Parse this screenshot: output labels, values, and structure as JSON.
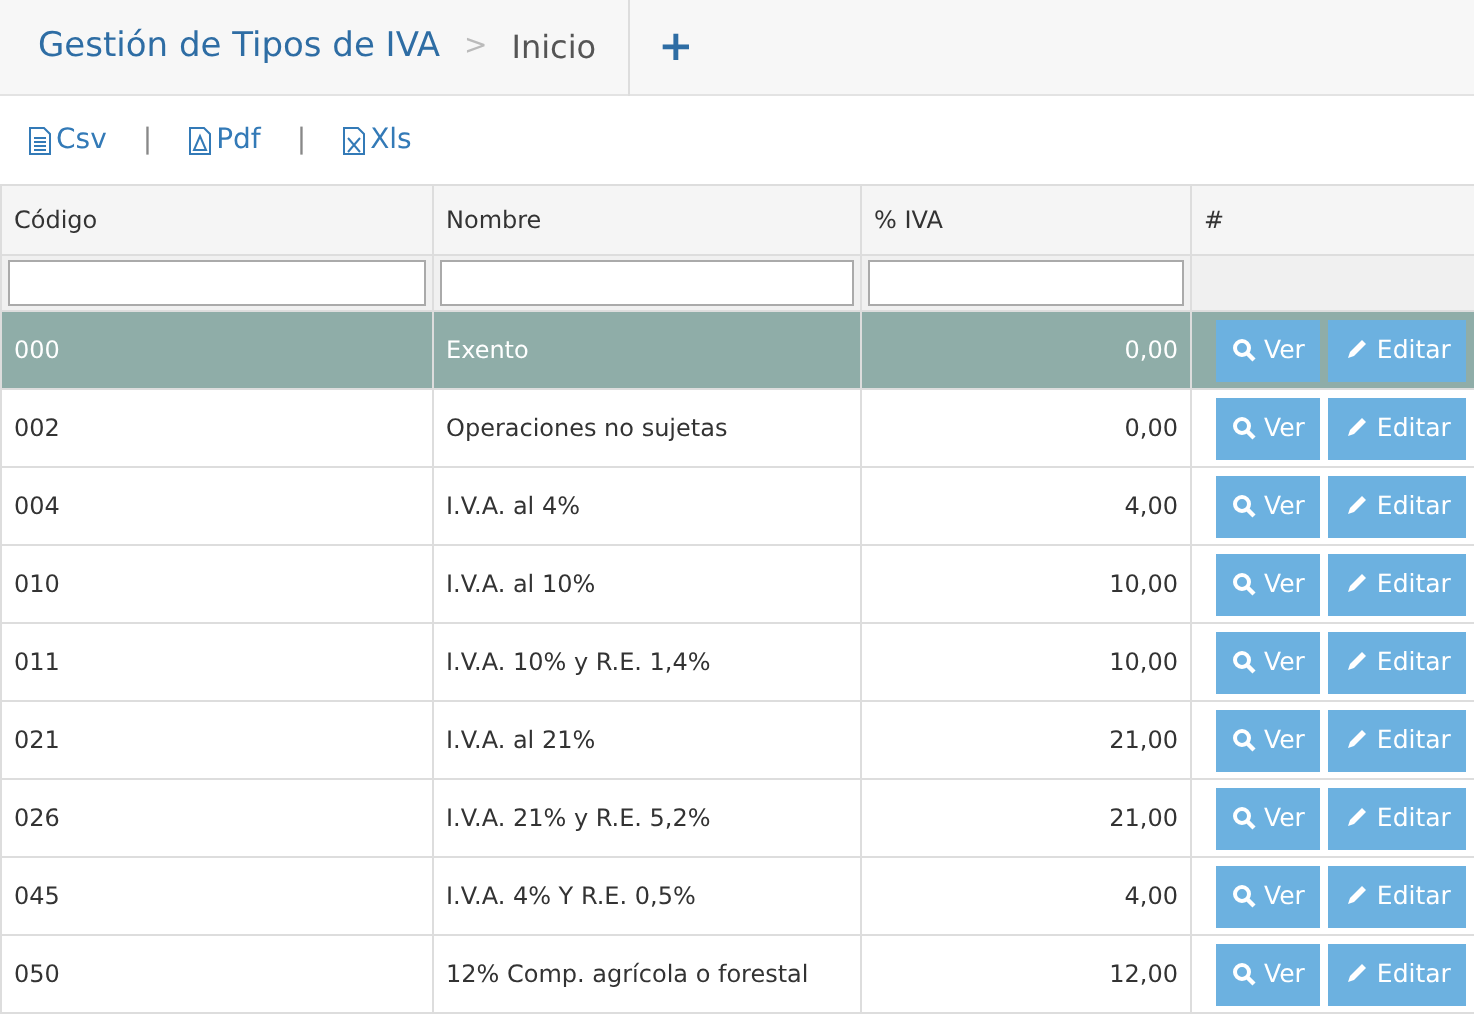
{
  "header": {
    "title": "Gestión de Tipos de IVA",
    "separator": ">",
    "crumb": "Inicio",
    "add": "+"
  },
  "exports": [
    {
      "kind": "csv",
      "label": "Csv"
    },
    {
      "kind": "pdf",
      "label": "Pdf"
    },
    {
      "kind": "xls",
      "label": "Xls"
    }
  ],
  "export_separator": "|",
  "table": {
    "columns": [
      "Código",
      "Nombre",
      "% IVA",
      "#"
    ],
    "rows": [
      {
        "code": "000",
        "name": "Exento",
        "iva": "0,00",
        "selected": true,
        "actions": [
          {
            "kind": "view",
            "label": "Ver"
          },
          {
            "kind": "edit",
            "label": "Editar"
          }
        ]
      },
      {
        "code": "002",
        "name": "Operaciones no sujetas",
        "iva": "0,00",
        "selected": false,
        "actions": [
          {
            "kind": "view",
            "label": "Ver"
          },
          {
            "kind": "edit",
            "label": "Editar"
          }
        ]
      },
      {
        "code": "004",
        "name": "I.V.A. al 4%",
        "iva": "4,00",
        "selected": false,
        "actions": [
          {
            "kind": "view",
            "label": "Ver"
          },
          {
            "kind": "edit",
            "label": "Editar"
          }
        ]
      },
      {
        "code": "010",
        "name": "I.V.A. al 10%",
        "iva": "10,00",
        "selected": false,
        "actions": [
          {
            "kind": "view",
            "label": "Ver"
          },
          {
            "kind": "edit",
            "label": "Editar"
          }
        ]
      },
      {
        "code": "011",
        "name": "I.V.A. 10% y R.E. 1,4%",
        "iva": "10,00",
        "selected": false,
        "actions": [
          {
            "kind": "view",
            "label": "Ver"
          },
          {
            "kind": "edit",
            "label": "Editar"
          }
        ]
      },
      {
        "code": "021",
        "name": "I.V.A. al 21%",
        "iva": "21,00",
        "selected": false,
        "actions": [
          {
            "kind": "view",
            "label": "Ver"
          },
          {
            "kind": "edit",
            "label": "Editar"
          }
        ]
      },
      {
        "code": "026",
        "name": "I.V.A. 21% y R.E. 5,2%",
        "iva": "21,00",
        "selected": false,
        "actions": [
          {
            "kind": "view",
            "label": "Ver"
          },
          {
            "kind": "edit",
            "label": "Editar"
          }
        ]
      },
      {
        "code": "045",
        "name": "I.V.A. 4% Y R.E. 0,5%",
        "iva": "4,00",
        "selected": false,
        "actions": [
          {
            "kind": "view",
            "label": "Ver"
          },
          {
            "kind": "edit",
            "label": "Editar"
          }
        ]
      },
      {
        "code": "050",
        "name": "12% Comp. agrícola o forestal",
        "iva": "12,00",
        "selected": false,
        "actions": [
          {
            "kind": "view",
            "label": "Ver"
          },
          {
            "kind": "edit",
            "label": "Editar"
          }
        ]
      }
    ]
  }
}
